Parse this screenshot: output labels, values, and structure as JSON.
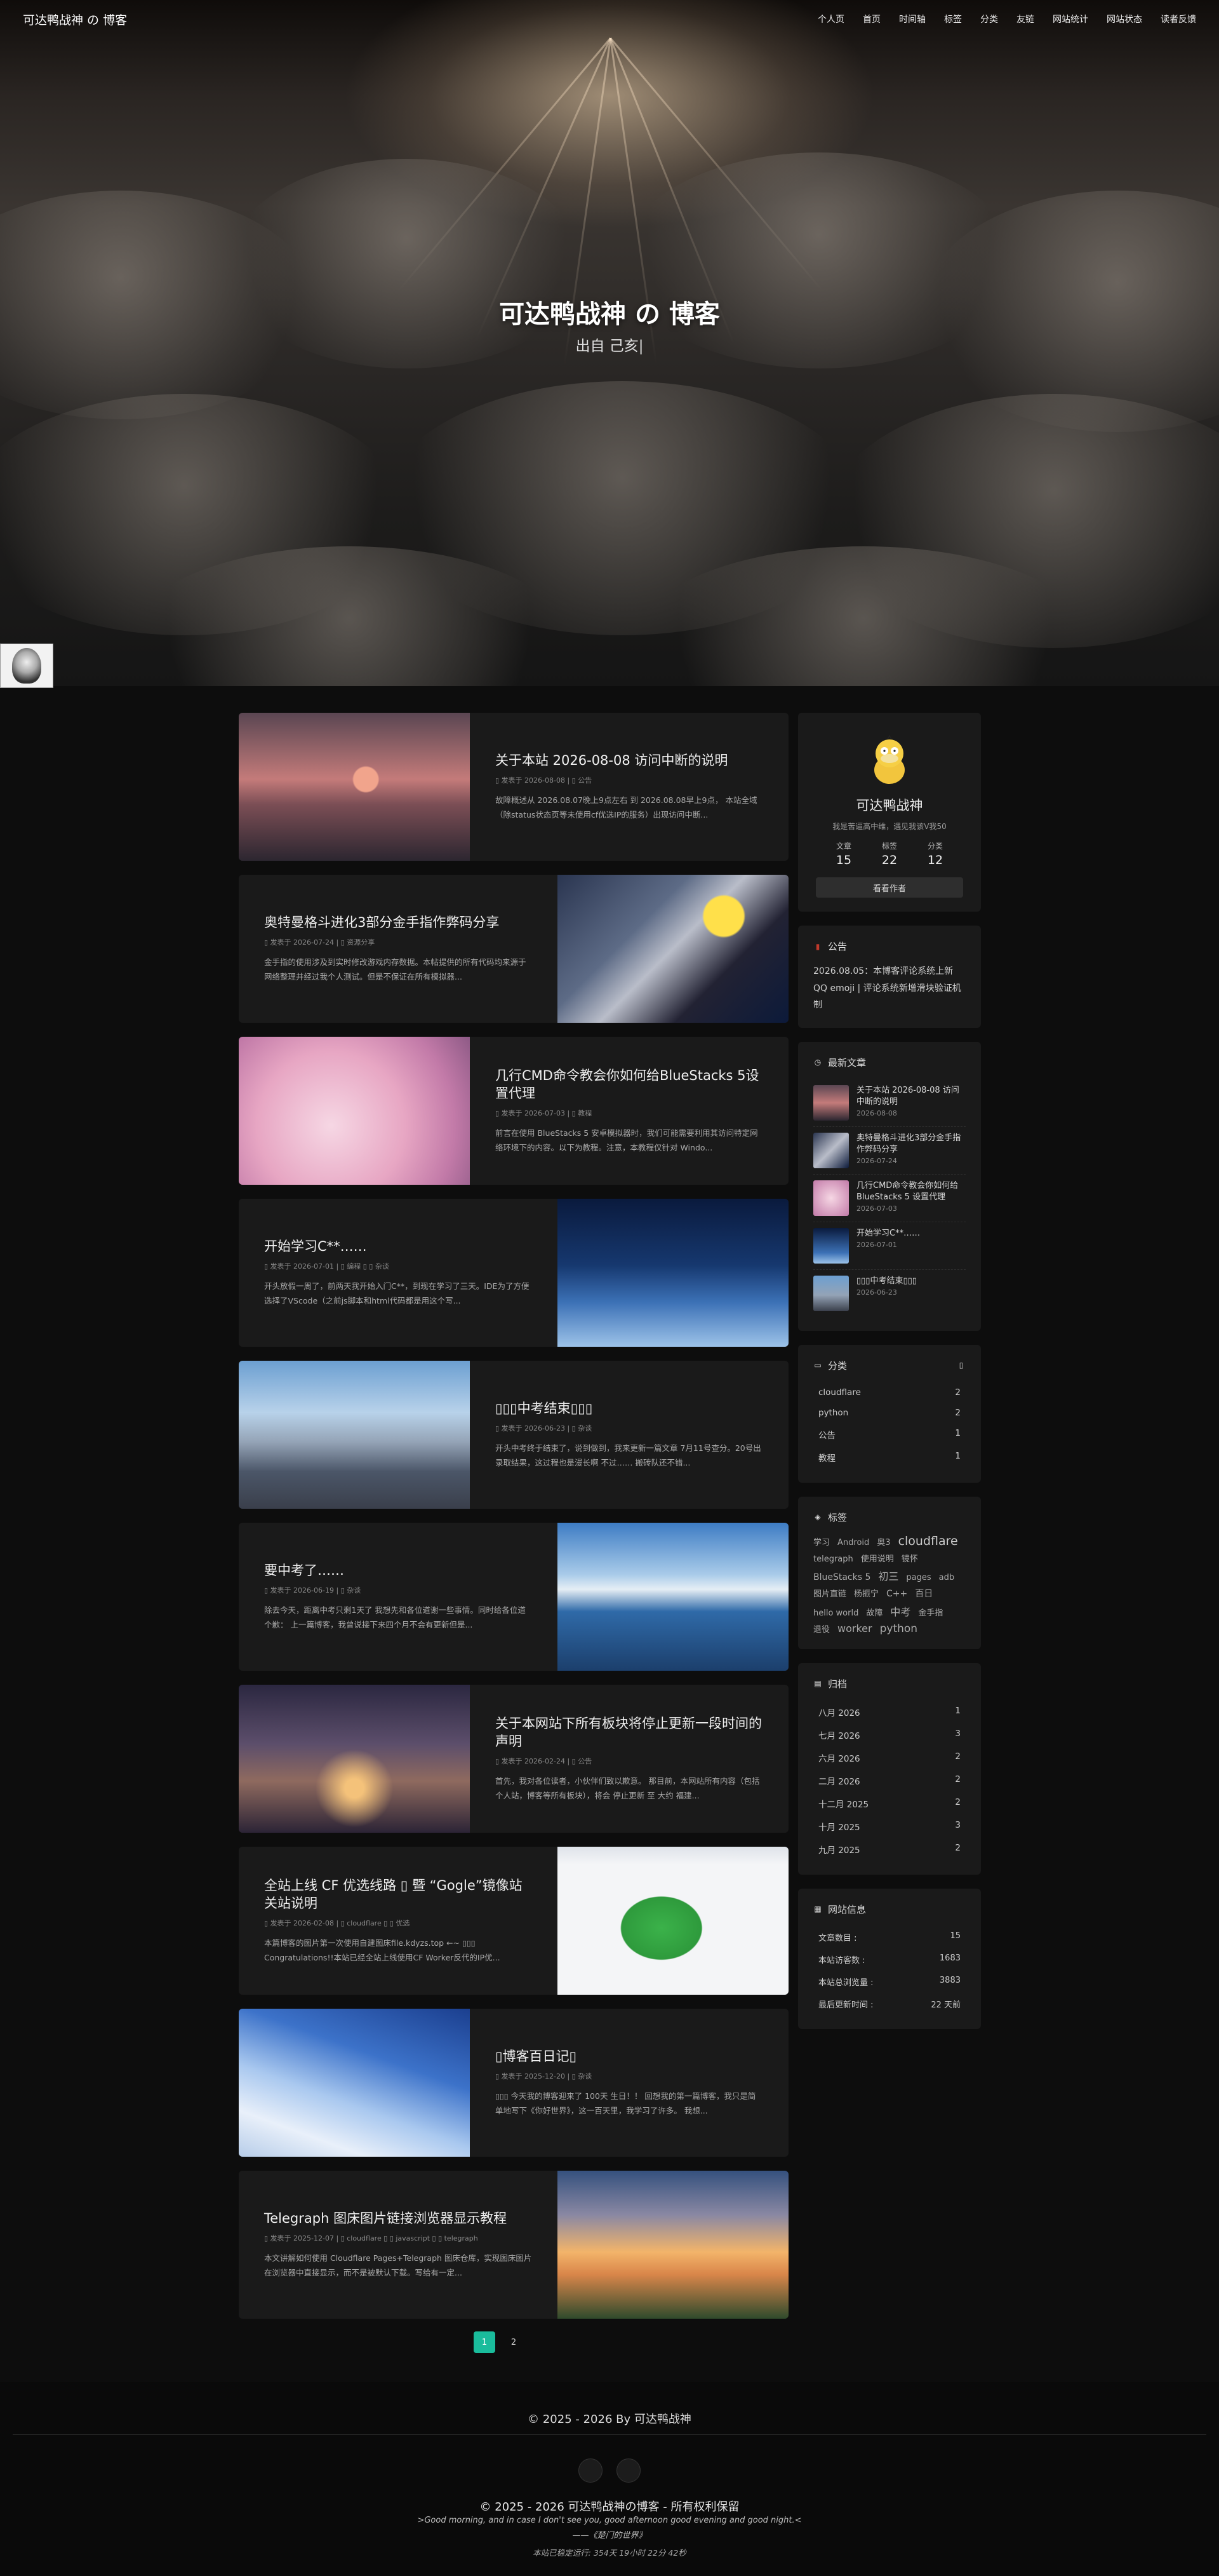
{
  "nav": {
    "brand": "可达鸭战神 の 博客",
    "items": [
      {
        "icon": "",
        "label": "个人页"
      },
      {
        "icon": "",
        "label": "首页"
      },
      {
        "icon": "",
        "label": "时间轴"
      },
      {
        "icon": "",
        "label": "标签"
      },
      {
        "icon": "",
        "label": "分类"
      },
      {
        "icon": "",
        "label": "友链"
      },
      {
        "icon": "",
        "label": "网站统计"
      },
      {
        "icon": "",
        "label": "网站状态"
      },
      {
        "icon": "",
        "label": "读者反馈"
      }
    ]
  },
  "hero": {
    "title": "可达鸭战神 の 博客",
    "subtitle": "出自 己亥|",
    "scroll_icon": ""
  },
  "posts": [
    {
      "title": "关于本站 2026-08-08 访问中断的说明",
      "meta": "▯ 发表于 2026-08-08 | ▯ 公告",
      "excerpt": "故障概述从 2026.08.07晚上9点左右 到 2026.08.08早上9点， 本站全域（除status状态页等未使用cf优选IP的服务）出现访问中断..."
    },
    {
      "title": "奥特曼格斗进化3部分金手指作弊码分享",
      "meta": "▯ 发表于 2026-07-24 | ▯ 资源分享",
      "excerpt": "金手指的使用涉及到实时修改游戏内存数据。本帖提供的所有代码均来源于网络整理并经过我个人测试。但是不保证在所有模拟器..."
    },
    {
      "title": "几行CMD命令教会你如何给BlueStacks 5设置代理",
      "meta": "▯ 发表于 2026-07-03 | ▯ 教程",
      "excerpt": "前言在使用 BlueStacks 5 安卓模拟器时，我们可能需要利用其访问特定网络环境下的内容。以下为教程。注意，本教程仅针对 Windo..."
    },
    {
      "title": "开始学习C**……",
      "meta": "▯ 发表于 2026-07-01 | ▯ 编程 ▯ ▯ 杂谈",
      "excerpt": "开头放假一周了，前两天我开始入门C**，到现在学习了三天。IDE为了方便选择了VScode（之前js脚本和html代码都是用这个写..."
    },
    {
      "title": "▯▯▯中考结束▯▯▯",
      "meta": "▯ 发表于 2026-06-23 | ▯ 杂谈",
      "excerpt": "开头中考终于结束了，说到做到，我来更新一篇文章 7月11号查分。20号出录取结果，这过程也是漫长啊 不过…… 搬砖队还不错..."
    },
    {
      "title": "要中考了……",
      "meta": "▯ 发表于 2026-06-19 | ▯ 杂谈",
      "excerpt": "除去今天，距离中考只剩1天了 我想先和各位道谢一些事情。同时给各位道个歉：  上一篇博客，我曾说接下来四个月不会有更新但是..."
    },
    {
      "title": "关于本网站下所有板块将停止更新一段时间的声明",
      "meta": "▯ 发表于 2026-02-24 | ▯ 公告",
      "excerpt": "首先，我对各位读者，小伙伴们致以歉意。 那目前，本网站所有内容（包括个人站，博客等所有板块），将会 停止更新 至 大约 福建..."
    },
    {
      "title": "全站上线 CF 优选线路 ▯ 暨 “Gogle”镜像站关站说明",
      "meta": "▯ 发表于 2026-02-08 | ▯ cloudflare ▯ ▯ 优选",
      "excerpt": "本篇博客的图片第一次使用自建图床file.kdyzs.top ←~ ▯▯▯ Congratulations!!本站已经全站上线使用CF Worker反代的IP优..."
    },
    {
      "title": "▯博客百日记▯",
      "meta": "▯ 发表于 2025-12-20 | ▯ 杂谈",
      "excerpt": "▯▯▯ 今天我的博客迎来了 100天 生日！！ 回想我的第一篇博客，我只是简单地写下《你好世界》，这一百天里，我学习了许多。 我想..."
    },
    {
      "title": "Telegraph 图床图片链接浏览器显示教程",
      "meta": "▯ 发表于 2025-12-07 | ▯ cloudflare ▯ ▯ javascript ▯ ▯ telegraph",
      "excerpt": "本文讲解如何使用 Cloudflare Pages+Telegraph 图床仓库，实现图床图片在浏览器中直接显示，而不是被默认下载。写给有一定..."
    }
  ],
  "pagination": {
    "pages": [
      "1",
      "2"
    ],
    "next": ""
  },
  "author": {
    "name": "可达鸭战神",
    "desc": "我是苦逼高中维，遇见我该V我50",
    "stats": [
      {
        "label": "文章",
        "value": "15"
      },
      {
        "label": "标签",
        "value": "22"
      },
      {
        "label": "分类",
        "value": "12"
      }
    ],
    "follow": " 看看作者"
  },
  "announcement": {
    "title": "公告",
    "text": "2026.08.05：本博客评论系统上新QQ emoji | 评论系统新增滑块验证机制"
  },
  "recent": {
    "title": "最新文章",
    "items": [
      {
        "title": "关于本站 2026-08-08 访问中断的说明",
        "date": "2026-08-08"
      },
      {
        "title": "奥特曼格斗进化3部分金手指作弊码分享",
        "date": "2026-07-24"
      },
      {
        "title": "几行CMD命令教会你如何给BlueStacks 5 设置代理",
        "date": "2026-07-03"
      },
      {
        "title": "开始学习C**……",
        "date": "2026-07-01"
      },
      {
        "title": "▯▯▯中考结束▯▯▯",
        "date": "2026-06-23"
      }
    ]
  },
  "categories": {
    "title": "分类",
    "items": [
      {
        "name": "cloudflare",
        "count": "2"
      },
      {
        "name": "python",
        "count": "2"
      },
      {
        "name": "公告",
        "count": "1"
      },
      {
        "name": "教程",
        "count": "1"
      }
    ]
  },
  "tags": {
    "title": "标签",
    "items": [
      "学习",
      "Android",
      "奥3",
      "cloudflare",
      "telegraph",
      "使用说明",
      "镜怀",
      "BlueStacks 5",
      "初三",
      "pages",
      "adb",
      "图片直链",
      "杨振宁",
      "C++",
      "百日",
      "hello world",
      "故障",
      "中考",
      "金手指",
      "退役",
      "worker",
      "python"
    ]
  },
  "archives": {
    "title": "归档",
    "items": [
      {
        "month": "八月 2026",
        "count": "1"
      },
      {
        "month": "七月 2026",
        "count": "3"
      },
      {
        "month": "六月 2026",
        "count": "2"
      },
      {
        "month": "二月 2026",
        "count": "2"
      },
      {
        "month": "十二月 2025",
        "count": "2"
      },
      {
        "month": "十月 2025",
        "count": "3"
      },
      {
        "month": "九月 2025",
        "count": "2"
      }
    ]
  },
  "siteinfo": {
    "title": "网站信息",
    "items": [
      {
        "label": "文章数目 :",
        "value": "15"
      },
      {
        "label": "本站访客数 :",
        "value": "1683"
      },
      {
        "label": "本站总浏览量 :",
        "value": "3883"
      },
      {
        "label": "最后更新时间 :",
        "value": "22 天前"
      }
    ]
  },
  "footer": {
    "copyright": "© 2025 - 2026 By 可达鸭战神",
    "social": [
      "",
      ""
    ],
    "rights": "© 2025 - 2026 可达鸭战神の博客 - 所有权利保留",
    "quote": ">Good morning, and in case I don't see you, good afternoon good evening and good night.<",
    "quote_src": "——《楚门的世界》",
    "runtime": "本站已稳定运行: 354天 19小时 22分 42秒"
  }
}
